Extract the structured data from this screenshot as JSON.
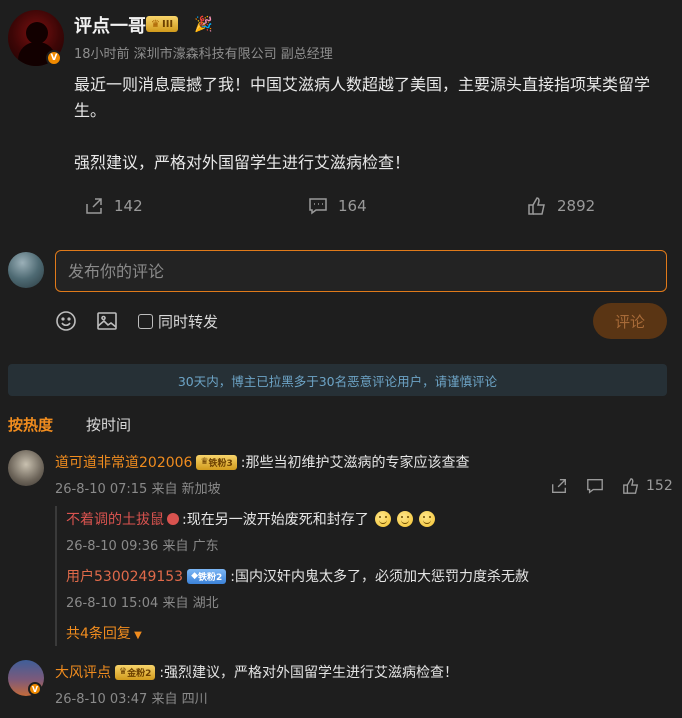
{
  "post": {
    "author": "评点一哥",
    "level_badge": "III",
    "meta": "18小时前  深圳市濠森科技有限公司 副总经理",
    "text_line1": "最近一则消息震撼了我！中国艾滋病人数超越了美国，主要源头直接指项某类留学生。",
    "text_line2": "强烈建议，严格对外国留学生进行艾滋病检查！",
    "shares": "142",
    "comments": "164",
    "likes": "2892"
  },
  "composer": {
    "placeholder": "发布你的评论",
    "repost_label": "同时转发",
    "submit_label": "评论"
  },
  "notice": "30天内，博主已拉黑多于30名恶意评论用户，请谨慎评论",
  "tabs": {
    "hot": "按热度",
    "time": "按时间"
  },
  "comments": [
    {
      "name": "道可道非常道202006",
      "badge": "铁粉3",
      "text": ":那些当初维护艾滋病的专家应该查查",
      "meta": "26-8-10 07:15 来自 新加坡",
      "likes": "152",
      "replies": [
        {
          "name": "不着调的土拔鼠",
          "text": ":现在另一波开始废死和封存了",
          "meta": "26-8-10 09:36 来自 广东"
        },
        {
          "name": "用户5300249153",
          "badge": "铁粉2",
          "text": ":国内汉奸内鬼太多了，必须加大惩罚力度杀无赦",
          "meta": "26-8-10 15:04 来自 湖北"
        }
      ],
      "more_replies": "共4条回复"
    },
    {
      "name": "大风评点",
      "badge": "金粉2",
      "text": ":强烈建议，严格对外国留学生进行艾滋病检查！",
      "meta": "26-8-10 03:47 来自 四川"
    }
  ],
  "colors": {
    "accent": "#f08c1e",
    "background": "#1e1e1e",
    "notice_text": "#6da4c6"
  }
}
